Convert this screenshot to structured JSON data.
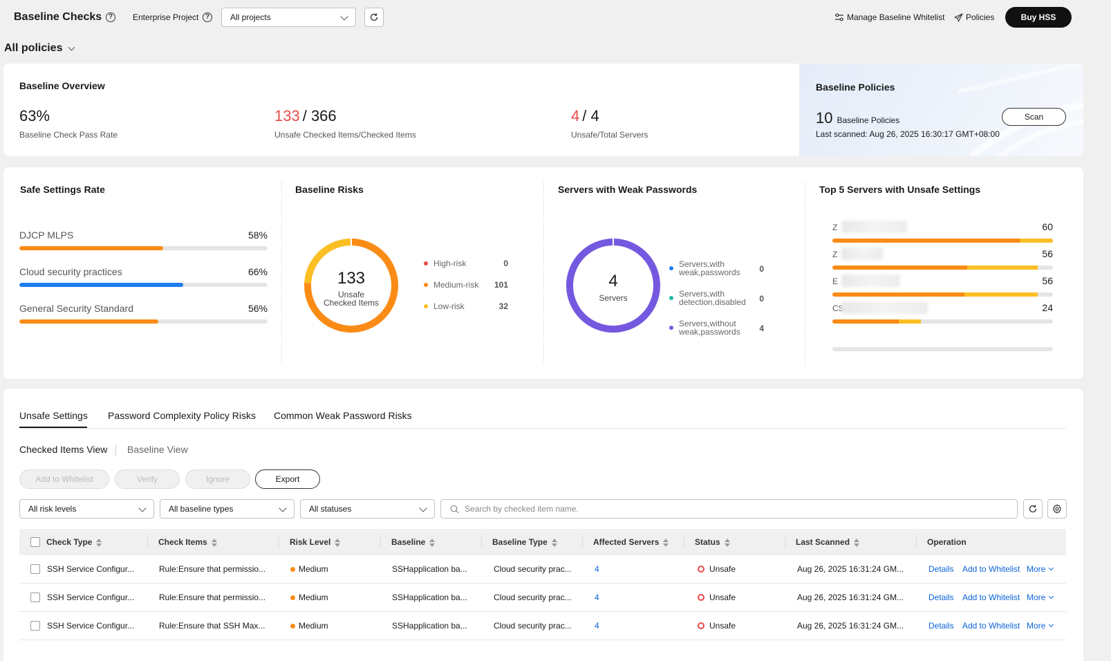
{
  "header": {
    "title": "Baseline Checks",
    "enterprise_project_label": "Enterprise Project",
    "project_select_value": "All projects",
    "manage_whitelist": "Manage Baseline Whitelist",
    "policies": "Policies",
    "buy": "Buy HSS"
  },
  "policy_selector": "All policies",
  "overview": {
    "title": "Baseline Overview",
    "pass_rate": "63%",
    "pass_rate_label": "Baseline Check Pass Rate",
    "unsafe_items": "133",
    "checked_items": "/ 366",
    "items_label": "Unsafe Checked Items/Checked Items",
    "unsafe_servers": "4",
    "total_servers": "/ 4",
    "servers_label": "Unsafe/Total Servers"
  },
  "policies_panel": {
    "title": "Baseline Policies",
    "count": "10",
    "count_label": "Baseline Policies",
    "last_scanned": "Last scanned: Aug 26, 2025 16:30:17 GMT+08:00",
    "scan_button": "Scan"
  },
  "safe_settings": {
    "title": "Safe Settings Rate",
    "items": [
      {
        "name": "DJCP MLPS",
        "pct_label": "58%",
        "value": 0.58,
        "color": "#fa8c16"
      },
      {
        "name": "Cloud security practices",
        "pct_label": "66%",
        "value": 0.66,
        "color": "#1f7cf0"
      },
      {
        "name": "General Security Standard",
        "pct_label": "56%",
        "value": 0.56,
        "color": "#fa8c16"
      }
    ]
  },
  "baseline_risks": {
    "title": "Baseline Risks",
    "center_value": "133",
    "center_label_1": "Unsafe",
    "center_label_2": "Checked Items",
    "legend": [
      {
        "label": "High-risk",
        "value": "0",
        "color": "#e84a4a"
      },
      {
        "label": "Medium-risk",
        "value": "101",
        "color": "#fa8c16"
      },
      {
        "label": "Low-risk",
        "value": "32",
        "color": "#fbbf24"
      }
    ],
    "chart_data": {
      "type": "pie",
      "categories": [
        "High-risk",
        "Medium-risk",
        "Low-risk"
      ],
      "values": [
        0,
        101,
        32
      ]
    }
  },
  "weak_passwords": {
    "title": "Servers with Weak Passwords",
    "center_value": "4",
    "center_label": "Servers",
    "legend": [
      {
        "label_1": "Servers,with",
        "label_2": "weak,passwords",
        "value": "0",
        "color": "#1f7cf0"
      },
      {
        "label_1": "Servers,with",
        "label_2": "detection,disabled",
        "value": "0",
        "color": "#21b8a6"
      },
      {
        "label_1": "Servers,without",
        "label_2": "weak,passwords",
        "value": "4",
        "color": "#7459e0"
      }
    ],
    "chart_data": {
      "type": "pie",
      "categories": [
        "Servers,with weak,passwords",
        "Servers,with detection,disabled",
        "Servers,without weak,passwords"
      ],
      "values": [
        0,
        0,
        4
      ]
    }
  },
  "top5": {
    "title": "Top 5 Servers with Unsafe Settings",
    "servers": [
      {
        "prefix": "Z",
        "value": "60",
        "medium": 0.85,
        "low": 0.15
      },
      {
        "prefix": "Z",
        "value": "56",
        "medium": 0.61,
        "low": 0.32
      },
      {
        "prefix": "E",
        "value": "56",
        "medium": 0.6,
        "low": 0.33
      },
      {
        "prefix": "CS",
        "value": "24",
        "medium": 0.3,
        "low": 0.1
      }
    ]
  },
  "tabs": [
    "Unsafe Settings",
    "Password Complexity Policy Risks",
    "Common Weak Password Risks"
  ],
  "views": [
    "Checked Items View",
    "Baseline View"
  ],
  "actions": {
    "add_whitelist": "Add to Whitelist",
    "verify": "Verify",
    "ignore": "Ignore",
    "export": "Export"
  },
  "filters": {
    "risk": "All risk levels",
    "baseline_type": "All baseline types",
    "status": "All statuses",
    "search_placeholder": "Search by checked item name."
  },
  "table": {
    "columns": [
      "Check Type",
      "Check Items",
      "Risk Level",
      "Baseline",
      "Baseline Type",
      "Affected Servers",
      "Status",
      "Last Scanned",
      "Operation"
    ],
    "rows": [
      {
        "check_type": "SSH Service Configur...",
        "check_item": "Rule:Ensure that permissio...",
        "risk": "Medium",
        "baseline": "SSHapplication ba...",
        "baseline_type": "Cloud security prac...",
        "affected": "4",
        "status": "Unsafe",
        "scanned": "Aug 26, 2025 16:31:24 GM...",
        "op_details": "Details",
        "op_whitelist": "Add to Whitelist",
        "op_more": "More"
      },
      {
        "check_type": "SSH Service Configur...",
        "check_item": "Rule:Ensure that permissio...",
        "risk": "Medium",
        "baseline": "SSHapplication ba...",
        "baseline_type": "Cloud security prac...",
        "affected": "4",
        "status": "Unsafe",
        "scanned": "Aug 26, 2025 16:31:24 GM...",
        "op_details": "Details",
        "op_whitelist": "Add to Whitelist",
        "op_more": "More"
      },
      {
        "check_type": "SSH Service Configur...",
        "check_item": "Rule:Ensure that SSH Max...",
        "risk": "Medium",
        "baseline": "SSHapplication ba...",
        "baseline_type": "Cloud security prac...",
        "affected": "4",
        "status": "Unsafe",
        "scanned": "Aug 26, 2025 16:31:24 GM...",
        "op_details": "Details",
        "op_whitelist": "Add to Whitelist",
        "op_more": "More"
      }
    ]
  },
  "colors": {
    "accent": "#0b63d8",
    "danger": "#e84a4a",
    "medium": "#fa8c16",
    "low": "#fbbf24",
    "purple": "#7459e0"
  }
}
